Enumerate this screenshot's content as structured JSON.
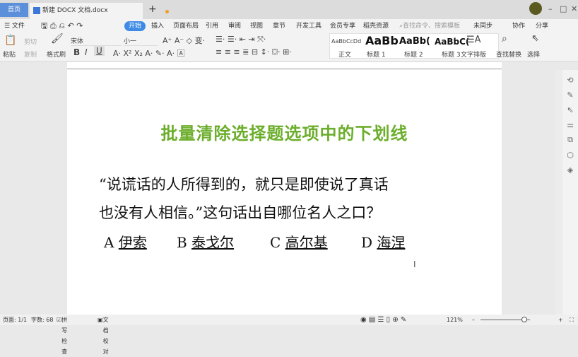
{
  "tabs": {
    "home": "首页",
    "document": "新建 DOCX 文档.docx",
    "new": "+"
  },
  "window": {
    "minimize": "–",
    "maximize": "□",
    "close": "✕"
  },
  "menu": {
    "file": "☰ 文件",
    "items": [
      "开始",
      "插入",
      "页面布局",
      "引用",
      "审阅",
      "视图",
      "章节",
      "开发工具",
      "会员专享",
      "稻壳资源"
    ],
    "search_placeholder": "查找命令、搜索模板",
    "sync": "未同步",
    "collab": "协作",
    "share": "分享"
  },
  "toolbar": {
    "paste": "粘贴",
    "cut": "剪切",
    "copy": "复制",
    "format_painter": "格式刷",
    "font": "宋体",
    "size": "小一",
    "bold": "B",
    "italic": "I",
    "underline": "U",
    "styles": [
      {
        "preview": "AaBbCcDd",
        "label": "正文"
      },
      {
        "preview": "AaBb",
        "label": "标题 1"
      },
      {
        "preview": "AaBb(",
        "label": "标题 2"
      },
      {
        "preview": "AaBbC(",
        "label": "标题 3"
      }
    ],
    "text_layout": "文字排版",
    "find_replace": "查找替换",
    "select": "选择"
  },
  "document": {
    "title": "批量清除选择题选项中的下划线",
    "line1": "“说谎话的人所得到的，就只是即使说了真话",
    "line2": "也没有人相信。”这句话出自哪位名人之口？",
    "options": [
      {
        "letter": "A",
        "text": "伊索"
      },
      {
        "letter": "B",
        "text": "泰戈尔"
      },
      {
        "letter": "C",
        "text": "高尔基"
      },
      {
        "letter": "D",
        "text": "海涅"
      }
    ]
  },
  "status": {
    "page": "页面: 1/1",
    "words": "字数: 68",
    "spellcheck": "拼写检查",
    "proofread": "文档校对",
    "zoom": "121%"
  },
  "colors": {
    "title": "#6cae2c",
    "accent": "#3e8ae6"
  }
}
